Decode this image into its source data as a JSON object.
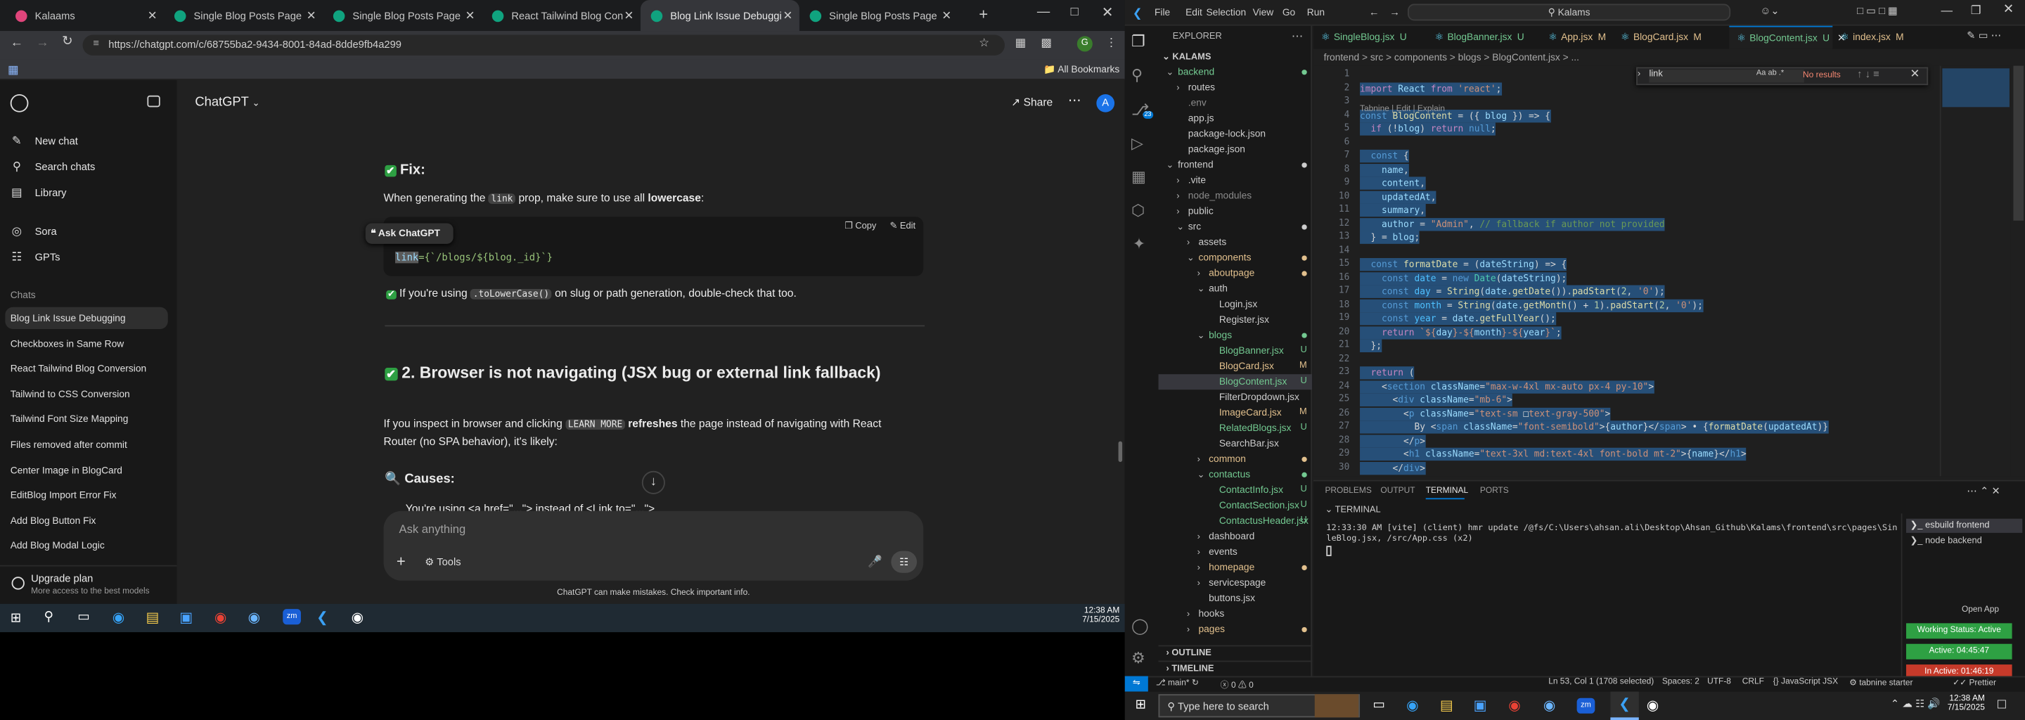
{
  "chrome": {
    "tabs": [
      {
        "title": "Kalaams",
        "color": "#e0457b"
      },
      {
        "title": "Single Blog Posts Page Desig",
        "color": "#10a37f"
      },
      {
        "title": "Single Blog Posts Page Desig",
        "color": "#10a37f"
      },
      {
        "title": "React Tailwind Blog Convers",
        "color": "#10a37f"
      },
      {
        "title": "Blog Link Issue Debugging",
        "color": "#10a37f"
      },
      {
        "title": "Single Blog Posts Page Desig",
        "color": "#10a37f"
      }
    ],
    "url": "https://chatgpt.com/c/68755ba2-9434-8001-84ad-8dde9fb4a299",
    "all_bookmarks": "All Bookmarks",
    "profile_initial": "G"
  },
  "gpt": {
    "sidebar": {
      "top": [
        {
          "label": "New chat",
          "icon": "pencil-icon"
        },
        {
          "label": "Search chats",
          "icon": "search-icon"
        },
        {
          "label": "Library",
          "icon": "library-icon"
        }
      ],
      "apps": [
        {
          "label": "Sora",
          "icon": "sora-icon"
        },
        {
          "label": "GPTs",
          "icon": "gpts-icon"
        }
      ],
      "chats_heading": "Chats",
      "chats": [
        "Blog Link Issue Debugging",
        "Checkboxes in Same Row",
        "React Tailwind Blog Conversion",
        "Tailwind to CSS Conversion",
        "Tailwind Font Size Mapping",
        "Files removed after commit",
        "Center Image in BlogCard",
        "EditBlog Import Error Fix",
        "Add Blog Button Fix",
        "Add Blog Modal Logic"
      ],
      "upgrade_title": "Upgrade plan",
      "upgrade_sub": "More access to the best models"
    },
    "header": {
      "model": "ChatGPT",
      "share": "Share",
      "avatar": "A"
    },
    "content": {
      "fix_heading": "Fix:",
      "fix_text_a": "When generating the ",
      "fix_chip": "link",
      "fix_text_b": " prop, make sure to use all ",
      "fix_bold": "lowercase",
      "fix_text_c": ":",
      "ask_chatgpt": "Ask ChatGPT",
      "copy": "Copy",
      "edit": "Edit",
      "code_sel": "link",
      "code_rest": "={`/blogs/${blog._id}`}",
      "check_a": "If you're using ",
      "check_chip": ".toLowerCase()",
      "check_b": " on slug or path generation, double-check that too.",
      "h2": "2. Browser is not navigating (JSX bug or external link fallback)",
      "p_a": "If you inspect in browser and clicking ",
      "p_chip": "LEARN MORE",
      "p_b": " refreshes",
      "p_c": " the page instead of navigating with React Router (no SPA behavior), it's likely:",
      "causes": "Causes:",
      "cut_line": "You're using <a href=\"...\"> instead of <Link to=\"...\">"
    },
    "composer": {
      "placeholder": "Ask anything",
      "tools": "Tools",
      "disclaimer": "ChatGPT can make mistakes. Check important info."
    }
  },
  "taskbar_left": {
    "time": "12:38 AM",
    "date": "7/15/2025"
  },
  "vscode": {
    "menu": [
      "File",
      "Edit",
      "Selection",
      "View",
      "Go",
      "Run"
    ],
    "search": "Kalams",
    "explorer_title": "EXPLORER",
    "root": "KALAMS",
    "tree": [
      {
        "n": "backend",
        "d": 0,
        "t": "folder-open",
        "c": "#73c991",
        "dot": true
      },
      {
        "n": "routes",
        "d": 1,
        "t": "folder",
        "c": "#cccccc"
      },
      {
        "n": ".env",
        "d": 1,
        "t": "file",
        "c": "#8b8b8b"
      },
      {
        "n": "app.js",
        "d": 1,
        "t": "file",
        "c": "#cccccc"
      },
      {
        "n": "package-lock.json",
        "d": 1,
        "t": "file",
        "c": "#cccccc"
      },
      {
        "n": "package.json",
        "d": 1,
        "t": "file",
        "c": "#cccccc"
      },
      {
        "n": "frontend",
        "d": 0,
        "t": "folder-open",
        "c": "#cccccc",
        "dot": true
      },
      {
        "n": ".vite",
        "d": 1,
        "t": "folder",
        "c": "#cccccc"
      },
      {
        "n": "node_modules",
        "d": 1,
        "t": "folder",
        "c": "#8b8b8b"
      },
      {
        "n": "public",
        "d": 1,
        "t": "folder",
        "c": "#cccccc"
      },
      {
        "n": "src",
        "d": 1,
        "t": "folder-open",
        "c": "#cccccc",
        "dot": true
      },
      {
        "n": "assets",
        "d": 2,
        "t": "folder",
        "c": "#cccccc"
      },
      {
        "n": "components",
        "d": 2,
        "t": "folder-open",
        "c": "#e2c08d",
        "dot": true
      },
      {
        "n": "aboutpage",
        "d": 3,
        "t": "folder",
        "c": "#e2c08d",
        "dot": true
      },
      {
        "n": "auth",
        "d": 3,
        "t": "folder-open",
        "c": "#cccccc"
      },
      {
        "n": "Login.jsx",
        "d": 4,
        "t": "file",
        "c": "#cccccc"
      },
      {
        "n": "Register.jsx",
        "d": 4,
        "t": "file",
        "c": "#cccccc"
      },
      {
        "n": "blogs",
        "d": 3,
        "t": "folder-open",
        "c": "#73c991",
        "dot": true
      },
      {
        "n": "BlogBanner.jsx",
        "d": 4,
        "t": "file",
        "c": "#73c991",
        "badge": "U"
      },
      {
        "n": "BlogCard.jsx",
        "d": 4,
        "t": "file",
        "c": "#e2c08d",
        "badge": "M"
      },
      {
        "n": "BlogContent.jsx",
        "d": 4,
        "t": "file",
        "c": "#73c991",
        "badge": "U",
        "sel": true
      },
      {
        "n": "FilterDropdown.jsx",
        "d": 4,
        "t": "file",
        "c": "#cccccc"
      },
      {
        "n": "ImageCard.jsx",
        "d": 4,
        "t": "file",
        "c": "#e2c08d",
        "badge": "M"
      },
      {
        "n": "RelatedBlogs.jsx",
        "d": 4,
        "t": "file",
        "c": "#73c991",
        "badge": "U"
      },
      {
        "n": "SearchBar.jsx",
        "d": 4,
        "t": "file",
        "c": "#cccccc"
      },
      {
        "n": "common",
        "d": 3,
        "t": "folder",
        "c": "#e2c08d",
        "dot": true
      },
      {
        "n": "contactus",
        "d": 3,
        "t": "folder-open",
        "c": "#73c991",
        "dot": true
      },
      {
        "n": "ContactInfo.jsx",
        "d": 4,
        "t": "file",
        "c": "#73c991",
        "badge": "U"
      },
      {
        "n": "ContactSection.jsx",
        "d": 4,
        "t": "file",
        "c": "#73c991",
        "badge": "U"
      },
      {
        "n": "ContactusHeader.jsx",
        "d": 4,
        "t": "file",
        "c": "#73c991",
        "badge": "U"
      },
      {
        "n": "dashboard",
        "d": 3,
        "t": "folder",
        "c": "#cccccc"
      },
      {
        "n": "events",
        "d": 3,
        "t": "folder",
        "c": "#cccccc"
      },
      {
        "n": "homepage",
        "d": 3,
        "t": "folder",
        "c": "#e2c08d",
        "dot": true
      },
      {
        "n": "servicespage",
        "d": 3,
        "t": "folder",
        "c": "#cccccc"
      },
      {
        "n": "buttons.jsx",
        "d": 3,
        "t": "file",
        "c": "#cccccc"
      },
      {
        "n": "hooks",
        "d": 2,
        "t": "folder",
        "c": "#cccccc"
      },
      {
        "n": "pages",
        "d": 2,
        "t": "folder",
        "c": "#e2c08d",
        "dot": true
      }
    ],
    "outline": "OUTLINE",
    "timeline": "TIMELINE",
    "editor_tabs": [
      {
        "name": "SingleBlog.jsx",
        "s": "U",
        "c": "#73c991"
      },
      {
        "name": "BlogBanner.jsx",
        "s": "U",
        "c": "#73c991"
      },
      {
        "name": "App.jsx",
        "s": "M",
        "c": "#e2c08d"
      },
      {
        "name": "BlogCard.jsx",
        "s": "M",
        "c": "#e2c08d"
      },
      {
        "name": "BlogContent.jsx",
        "s": "U",
        "c": "#73c991",
        "active": true
      },
      {
        "name": "index.jsx",
        "s": "M",
        "c": "#e2c08d"
      }
    ],
    "breadcrumb": "frontend > src > components > blogs > BlogContent.jsx > ...",
    "find": {
      "value": "link",
      "result": "No results"
    },
    "codelens": "Tabnine | Edit | Explain",
    "code": [
      {
        "n": "1",
        "h": ""
      },
      {
        "n": "2",
        "h": "<span class='kw'>import</span> <span class='vr'>React</span> <span class='kw'>from</span> <span class='st'>'react'</span><span class='pu'>;</span>"
      },
      {
        "n": "3",
        "h": ""
      },
      {
        "n": "4",
        "h": "<span class='kb'>const</span> <span class='fn'>BlogContent</span> <span class='pu'>= ({</span> <span class='vr'>blog</span> <span class='pu'>}) =&gt; {</span>"
      },
      {
        "n": "5",
        "h": "  <span class='kw'>if</span> <span class='pu'>(!</span><span class='vr'>blog</span><span class='pu'>)</span> <span class='kw'>return</span> <span class='kb'>null</span><span class='pu'>;</span>"
      },
      {
        "n": "6",
        "h": ""
      },
      {
        "n": "7",
        "h": "  <span class='kb'>const</span> <span class='pu'>{</span>"
      },
      {
        "n": "8",
        "h": "    <span class='vr'>name</span><span class='pu'>,</span>"
      },
      {
        "n": "9",
        "h": "    <span class='vr'>content</span><span class='pu'>,</span>"
      },
      {
        "n": "10",
        "h": "    <span class='vr'>updatedAt</span><span class='pu'>,</span>"
      },
      {
        "n": "11",
        "h": "    <span class='vr'>summary</span><span class='pu'>,</span>"
      },
      {
        "n": "12",
        "h": "    <span class='vr'>author</span> <span class='pu'>=</span> <span class='st'>\"Admin\"</span><span class='pu'>,</span> <span class='cm'>// fallback if author not provided</span>"
      },
      {
        "n": "13",
        "h": "  <span class='pu'>} =</span> <span class='vr'>blog</span><span class='pu'>;</span>"
      },
      {
        "n": "14",
        "h": ""
      },
      {
        "n": "15",
        "h": "  <span class='kb'>const</span> <span class='fn'>formatDate</span> <span class='pu'>= (</span><span class='vr'>dateString</span><span class='pu'>) =&gt; {</span>"
      },
      {
        "n": "16",
        "h": "    <span class='kb'>const</span> <span class='cn'>date</span> <span class='pu'>=</span> <span class='kb'>new</span> <span class='tg'>Date</span><span class='pu'>(</span><span class='vr'>dateString</span><span class='pu'>);</span>"
      },
      {
        "n": "17",
        "h": "    <span class='kb'>const</span> <span class='cn'>day</span> <span class='pu'>=</span> <span class='fn'>String</span><span class='pu'>(</span><span class='vr'>date</span><span class='pu'>.</span><span class='fn'>getDate</span><span class='pu'>()).</span><span class='fn'>padStart</span><span class='pu'>(</span><span class='nm'>2</span><span class='pu'>,</span> <span class='st'>'0'</span><span class='pu'>);</span>"
      },
      {
        "n": "18",
        "h": "    <span class='kb'>const</span> <span class='cn'>month</span> <span class='pu'>=</span> <span class='fn'>String</span><span class='pu'>(</span><span class='vr'>date</span><span class='pu'>.</span><span class='fn'>getMonth</span><span class='pu'>() +</span> <span class='nm'>1</span><span class='pu'>).</span><span class='fn'>padStart</span><span class='pu'>(</span><span class='nm'>2</span><span class='pu'>,</span> <span class='st'>'0'</span><span class='pu'>);</span>"
      },
      {
        "n": "19",
        "h": "    <span class='kb'>const</span> <span class='cn'>year</span> <span class='pu'>=</span> <span class='vr'>date</span><span class='pu'>.</span><span class='fn'>getFullYear</span><span class='pu'>();</span>"
      },
      {
        "n": "20",
        "h": "    <span class='kw'>return</span> <span class='st'>`${</span><span class='vr'>day</span><span class='st'>}-${</span><span class='vr'>month</span><span class='st'>}-${</span><span class='vr'>year</span><span class='st'>}`</span><span class='pu'>;</span>"
      },
      {
        "n": "21",
        "h": "  <span class='pu'>};</span>"
      },
      {
        "n": "22",
        "h": ""
      },
      {
        "n": "23",
        "h": "  <span class='kw'>return</span> <span class='pu'>(</span>"
      },
      {
        "n": "24",
        "h": "    <span class='pu'>&lt;</span><span class='kb'>section</span> <span class='at'>className</span><span class='pu'>=</span><span class='st'>\"max-w-4xl mx-auto px-4 py-10\"</span><span class='pu'>&gt;</span>"
      },
      {
        "n": "25",
        "h": "      <span class='pu'>&lt;</span><span class='kb'>div</span> <span class='at'>className</span><span class='pu'>=</span><span class='st'>\"mb-6\"</span><span class='pu'>&gt;</span>"
      },
      {
        "n": "26",
        "h": "        <span class='pu'>&lt;</span><span class='kb'>p</span> <span class='at'>className</span><span class='pu'>=</span><span class='st'>\"text-sm </span><span class='pu'>&#9633;</span><span class='st'>text-gray-500\"</span><span class='pu'>&gt;</span>"
      },
      {
        "n": "27",
        "h": "          <span class='tx'>By</span> <span class='pu'>&lt;</span><span class='kb'>span</span> <span class='at'>className</span><span class='pu'>=</span><span class='st'>\"font-semibold\"</span><span class='pu'>&gt;{</span><span class='vr'>author</span><span class='pu'>}&lt;/</span><span class='kb'>span</span><span class='pu'>&gt;</span> <span class='tx'>&#8226;</span> <span class='pu'>{</span><span class='fn'>formatDate</span><span class='pu'>(</span><span class='vr'>updatedAt</span><span class='pu'>)}</span>"
      },
      {
        "n": "28",
        "h": "        <span class='pu'>&lt;/</span><span class='kb'>p</span><span class='pu'>&gt;</span>"
      },
      {
        "n": "29",
        "h": "        <span class='pu'>&lt;</span><span class='kb'>h1</span> <span class='at'>className</span><span class='pu'>=</span><span class='st'>\"text-3xl md:text-4xl font-bold mt-2\"</span><span class='pu'>&gt;{</span><span class='vr'>name</span><span class='pu'>}&lt;/</span><span class='kb'>h1</span><span class='pu'>&gt;</span>"
      },
      {
        "n": "30",
        "h": "      <span class='pu'>&lt;/</span><span class='kb'>div</span><span class='pu'>&gt;</span>"
      }
    ],
    "panel_tabs": [
      "PROBLEMS",
      "OUTPUT",
      "TERMINAL",
      "PORTS"
    ],
    "terminal_title": "TERMINAL",
    "terminal_line1": "12:33:30 AM [vite] (client) hmr update /@fs/C:\\Users\\ahsan.ali\\Desktop\\Ahsan_Github\\Kalams\\frontend\\src\\pages\\Sing",
    "terminal_line2": "leBlog.jsx, /src/App.css (x2)",
    "terminals": [
      "esbuild  frontend",
      "node  backend"
    ],
    "open_app": "Open App",
    "working_status": "Working Status: Active",
    "active_time": "Active: 04:45:47",
    "in_active": "In Active: 01:46:19",
    "status": {
      "branch": "main*",
      "errors": "0 ⚠ 0",
      "cursor": "Ln 53, Col 1 (1708 selected)",
      "spaces": "Spaces: 2",
      "enc": "UTF-8",
      "eol": "CRLF",
      "lang": "JavaScript JSX",
      "tabnine": "tabnine starter",
      "prettier": "Prettier"
    }
  },
  "taskbar_right": {
    "search": "Type here to search",
    "time": "12:38 AM",
    "date": "7/15/2025"
  },
  "colors": {
    "accent": "#0078d4",
    "gpt_bg": "#212121",
    "vs_bg": "#1f1f1f",
    "selection": "#264f78",
    "green": "#2ea043",
    "red": "#c63a2a"
  }
}
